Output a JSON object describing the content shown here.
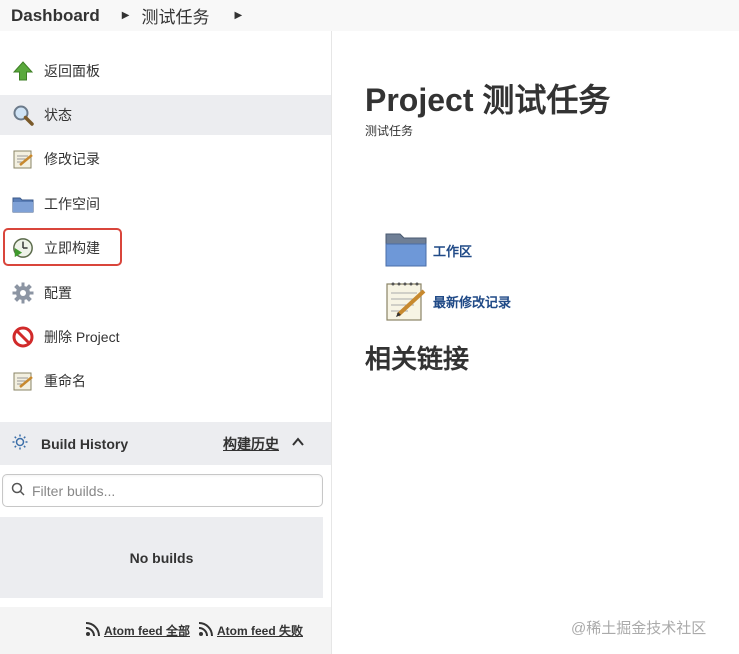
{
  "breadcrumb": {
    "dashboard": "Dashboard",
    "job": "测试任务"
  },
  "sidebar": {
    "items": [
      {
        "label": "返回面板",
        "icon": "up-arrow-icon"
      },
      {
        "label": "状态",
        "icon": "magnifier-icon"
      },
      {
        "label": "修改记录",
        "icon": "notepad-icon"
      },
      {
        "label": "工作空间",
        "icon": "folder-icon"
      },
      {
        "label": "立即构建",
        "icon": "clock-play-icon"
      },
      {
        "label": "配置",
        "icon": "gear-icon"
      },
      {
        "label": "删除 Project",
        "icon": "no-entry-icon"
      },
      {
        "label": "重命名",
        "icon": "notepad-icon"
      }
    ]
  },
  "build_history": {
    "title": "Build History",
    "trend": "构建历史",
    "filter_placeholder": "Filter builds...",
    "empty": "No builds",
    "feeds": [
      {
        "label": "Atom feed 全部"
      },
      {
        "label": "Atom feed 失败"
      }
    ]
  },
  "main": {
    "title": "Project 测试任务",
    "description": "测试任务",
    "links": [
      {
        "label": "工作区",
        "icon": "folder-icon"
      },
      {
        "label": "最新修改记录",
        "icon": "notepad-icon"
      }
    ],
    "related_heading": "相关链接"
  },
  "watermark": "@稀土掘金技术社区",
  "colors": {
    "highlight": "#d9453b",
    "link": "#204a87",
    "active_bg": "#ecedf0"
  }
}
